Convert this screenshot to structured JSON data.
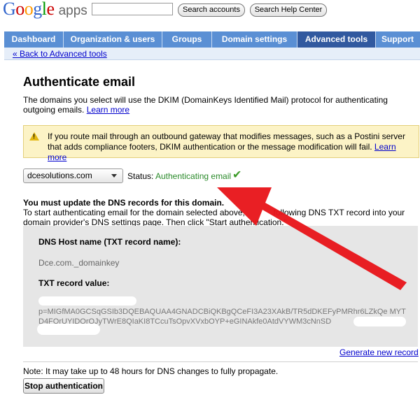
{
  "header": {
    "logo_google": [
      "G",
      "o",
      "o",
      "g",
      "l",
      "e"
    ],
    "logo_apps": "apps",
    "search_value": "",
    "search_accounts_label": "Search accounts",
    "search_help_label": "Search Help Center"
  },
  "nav": {
    "tabs": [
      {
        "label": "Dashboard"
      },
      {
        "label": "Organization & users"
      },
      {
        "label": "Groups"
      },
      {
        "label": "Domain settings"
      },
      {
        "label": "Advanced tools"
      },
      {
        "label": "Support"
      }
    ],
    "active_tab": "Advanced tools",
    "back_link": "« Back to Advanced tools"
  },
  "main": {
    "title": "Authenticate email",
    "intro": "The domains you select will use the DKIM (DomainKeys Identified Mail) protocol for authenticating outgoing emails.",
    "intro_link": "Learn more",
    "warning": "If you route mail through an outbound gateway that modifies messages, such as a Postini server that adds compliance footers, DKIM authentication or the message modification will fail.",
    "warning_link": "Learn more",
    "domain_select_value": "dcesolutions.com",
    "status_label": "Status:",
    "status_value": "Authenticating email",
    "dns_title": "You must update the DNS records for this domain.",
    "dns_text_1": "To start authenticating email for the domain selected above,",
    "dns_text_2": "following DNS TXT record into your domain provider's DNS settings page. Then click \"Start authentication.\"",
    "dns_host_label": "DNS Host name (TXT record name):",
    "dns_host_value": "Dce.com._domainkey",
    "txt_label": "TXT record value:",
    "txt_value": "p=MIGfMA0GCSqGSIb3DQEBAQUAA4GNADCBiQKBgQCeFI3A23XAkB/TR5dDKEFyPMRhr6LZkQe MYTD4FOrUYIDOrOJyTWrE8QIaKI8TCcuTsOpvXVxbOYP+eGINAkfe0AtdVYWM3cNnSD",
    "generate_link": "Generate new record",
    "note": "Note: It may take up to 48 hours for DNS changes to fully propagate.",
    "stop_button": "Stop authentication"
  },
  "colors": {
    "nav_blue": "#5a8fd4",
    "nav_active": "#31599f",
    "status_green": "#2a8a2a",
    "warning_bg": "#fcf3c6",
    "arrow_red": "#e8161b"
  },
  "icons": {
    "warning": "warning-triangle-icon",
    "check": "checkmark-icon",
    "caret": "chevron-down-icon"
  }
}
